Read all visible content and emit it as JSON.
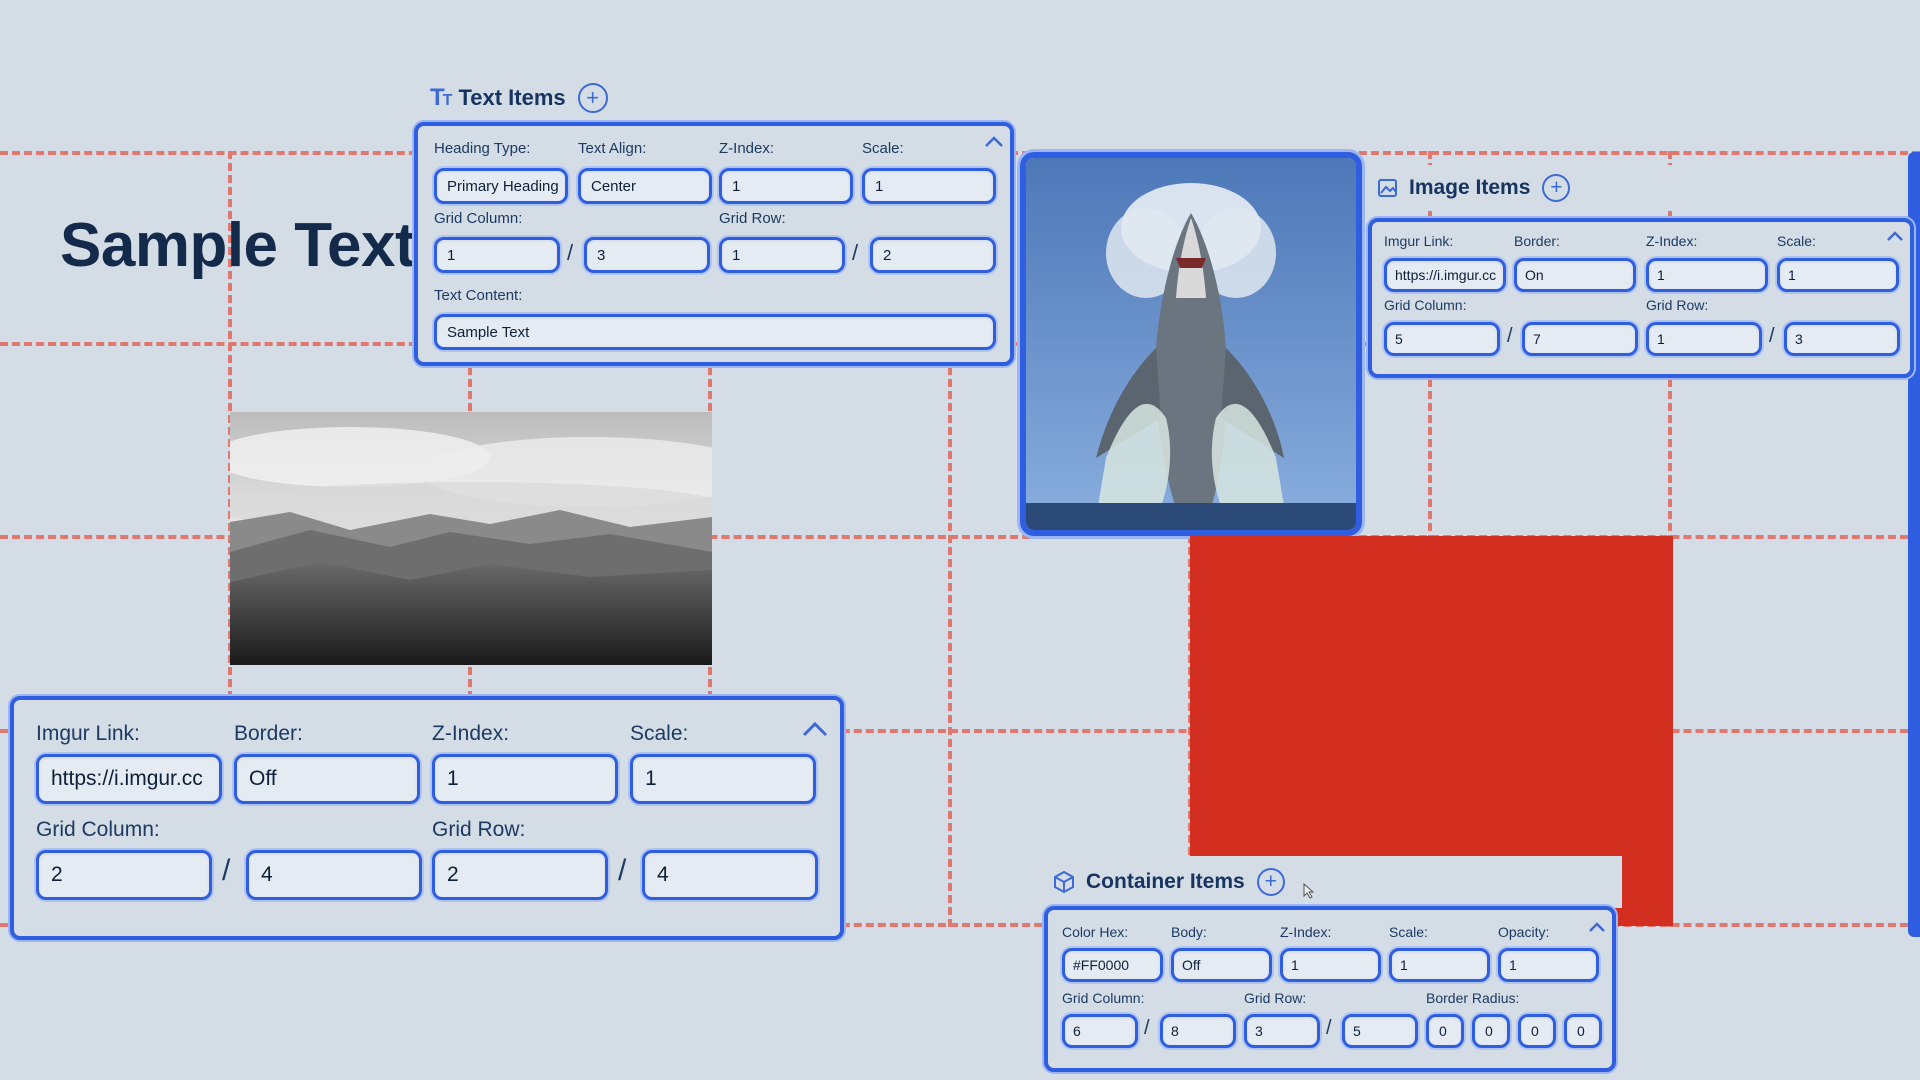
{
  "canvas": {
    "sample_text": "Sample Text",
    "grid_color": "#e07870",
    "red_container_color": "#d22f20"
  },
  "text_items": {
    "title": "Text Items",
    "icon": "text-type-icon",
    "labels": {
      "heading_type": "Heading Type:",
      "text_align": "Text Align:",
      "z_index": "Z-Index:",
      "scale": "Scale:",
      "grid_column": "Grid Column:",
      "grid_row": "Grid Row:",
      "text_content": "Text Content:"
    },
    "values": {
      "heading_type": "Primary Heading",
      "text_align": "Center",
      "z_index": "1",
      "scale": "1",
      "col_start": "1",
      "col_end": "3",
      "row_start": "1",
      "row_end": "2",
      "text_content": "Sample Text"
    }
  },
  "image_items": {
    "title": "Image Items",
    "icon": "image-icon",
    "labels": {
      "imgur_link": "Imgur Link:",
      "border": "Border:",
      "z_index": "Z-Index:",
      "scale": "Scale:",
      "grid_column": "Grid Column:",
      "grid_row": "Grid Row:"
    },
    "values": {
      "imgur_link": "https://i.imgur.cc",
      "border": "On",
      "z_index": "1",
      "scale": "1",
      "col_start": "5",
      "col_end": "7",
      "row_start": "1",
      "row_end": "3"
    }
  },
  "image_item_2": {
    "labels": {
      "imgur_link": "Imgur Link:",
      "border": "Border:",
      "z_index": "Z-Index:",
      "scale": "Scale:",
      "grid_column": "Grid Column:",
      "grid_row": "Grid Row:"
    },
    "values": {
      "imgur_link": "https://i.imgur.cc",
      "border": "Off",
      "z_index": "1",
      "scale": "1",
      "col_start": "2",
      "col_end": "4",
      "row_start": "2",
      "row_end": "4"
    }
  },
  "container_items": {
    "title": "Container Items",
    "icon": "cube-icon",
    "labels": {
      "color_hex": "Color Hex:",
      "body": "Body:",
      "z_index": "Z-Index:",
      "scale": "Scale:",
      "opacity": "Opacity:",
      "grid_column": "Grid Column:",
      "grid_row": "Grid Row:",
      "border_radius": "Border Radius:"
    },
    "values": {
      "color_hex": "#FF0000",
      "body": "Off",
      "z_index": "1",
      "scale": "1",
      "opacity": "1",
      "col_start": "6",
      "col_end": "8",
      "row_start": "3",
      "row_end": "5",
      "radius_1": "0",
      "radius_2": "0",
      "radius_3": "0",
      "radius_4": "0"
    }
  },
  "glyphs": {
    "plus": "+",
    "slash": "/"
  }
}
